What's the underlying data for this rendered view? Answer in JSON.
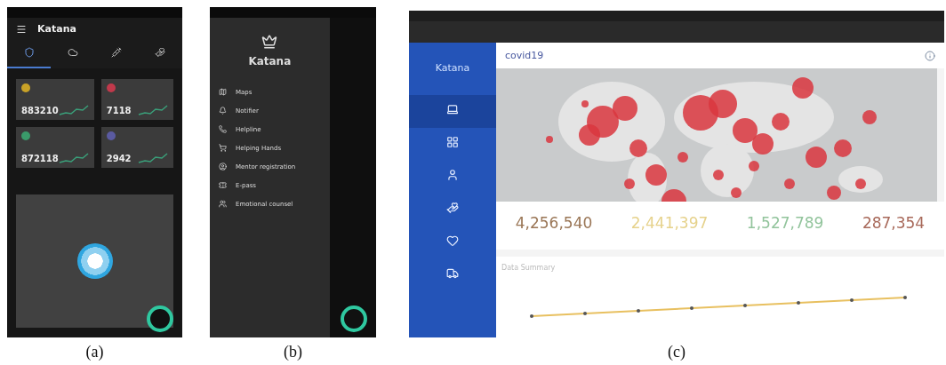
{
  "figures": [
    {
      "caption": "(a)",
      "phone_app": {
        "title": "Katana",
        "tabs": [
          {
            "kind": "home",
            "selected": true
          },
          {
            "kind": "cloud",
            "selected": false
          },
          {
            "kind": "vaccine",
            "selected": false
          },
          {
            "kind": "donate",
            "selected": false
          }
        ],
        "stats": [
          {
            "value": "883210",
            "color": "#c9a227"
          },
          {
            "value": "7118",
            "color": "#c0394b"
          },
          {
            "value": "872118",
            "color": "#3a9a6a"
          },
          {
            "value": "2942",
            "color": "#5a5aa0"
          }
        ]
      }
    },
    {
      "caption": "(b)",
      "drawer": {
        "title": "Katana",
        "items": [
          {
            "kind": "map",
            "label": "Maps"
          },
          {
            "kind": "bell",
            "label": "Notifier"
          },
          {
            "kind": "phone",
            "label": "Helpline"
          },
          {
            "kind": "cart",
            "label": "Helping Hands"
          },
          {
            "kind": "person",
            "label": "Mentor registration"
          },
          {
            "kind": "pass",
            "label": "E-pass"
          },
          {
            "kind": "group",
            "label": "Emotional counsel"
          }
        ]
      }
    },
    {
      "caption": "(c)",
      "web_dashboard": {
        "brand": "Katana",
        "page_title": "covid19",
        "nav": [
          {
            "kind": "laptop",
            "selected": true
          },
          {
            "kind": "grid",
            "selected": false
          },
          {
            "kind": "person",
            "selected": false
          },
          {
            "kind": "hand",
            "selected": false
          },
          {
            "kind": "heart",
            "selected": false
          },
          {
            "kind": "truck",
            "selected": false
          }
        ],
        "totals": [
          {
            "value": "4,256,540",
            "color": "#9a7656"
          },
          {
            "value": "2,441,397",
            "color": "#e6d28c"
          },
          {
            "value": "1,527,789",
            "color": "#92c49c"
          },
          {
            "value": "287,354",
            "color": "#a8695a"
          }
        ],
        "summary_title": "Data Summary"
      }
    }
  ]
}
